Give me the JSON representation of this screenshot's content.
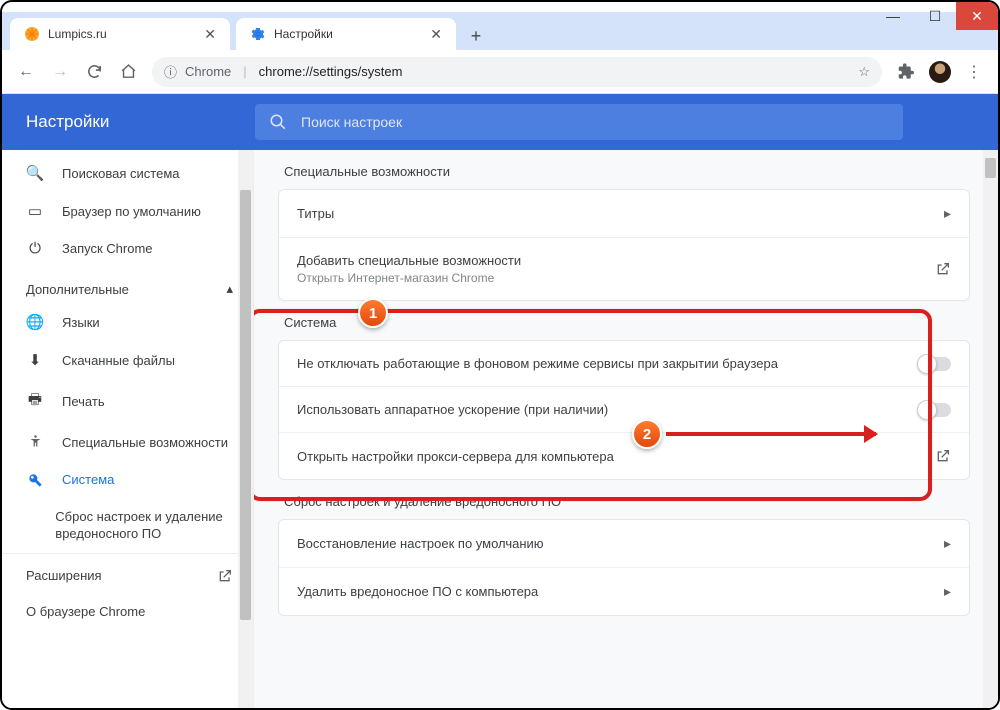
{
  "window": {
    "minimize": "—",
    "maximize": "☐",
    "close": "✕"
  },
  "tabs": [
    {
      "title": "Lumpics.ru",
      "icon": "orange-circle"
    },
    {
      "title": "Настройки",
      "icon": "gear-blue"
    }
  ],
  "newtab": "+",
  "nav": {
    "back": "←",
    "fwd": "→",
    "reload": "↻",
    "home": "⌂"
  },
  "omnibox": {
    "scheme_icon": "ⓘ",
    "scheme_label": "Chrome",
    "url": "chrome://settings/system",
    "star": "☆",
    "ext": "✦",
    "menu": "⋮"
  },
  "header": {
    "title": "Настройки",
    "search_placeholder": "Поиск настроек"
  },
  "sidebar": {
    "items": [
      {
        "icon": "🔍",
        "label": "Поисковая система"
      },
      {
        "icon": "▭",
        "label": "Браузер по умолчанию"
      },
      {
        "icon": "⏻",
        "label": "Запуск Chrome"
      }
    ],
    "adv_label": "Дополнительные",
    "adv_arrow": "▴",
    "adv_items": [
      {
        "icon": "🌐",
        "label": "Языки"
      },
      {
        "icon": "⬇",
        "label": "Скачанные файлы"
      },
      {
        "icon": "🖶",
        "label": "Печать"
      },
      {
        "icon": "✝",
        "label": "Специальные возможности"
      },
      {
        "icon": "🔧",
        "label": "Система",
        "active": true
      },
      {
        "icon": "",
        "label": "Сброс настроек и удаление вредоносного ПО"
      }
    ],
    "ext_label": "Расширения",
    "about_label": "О браузере Chrome"
  },
  "sections": {
    "a11y": {
      "title": "Специальные возможности",
      "row1": "Титры",
      "row2_main": "Добавить специальные возможности",
      "row2_sub": "Открыть Интернет-магазин Chrome"
    },
    "system": {
      "title": "Система",
      "row1": "Не отключать работающие в фоновом режиме сервисы при закрытии браузера",
      "row2": "Использовать аппаратное ускорение (при наличии)",
      "row3": "Открыть настройки прокси-сервера для компьютера"
    },
    "reset": {
      "title": "Сброс настроек и удаление вредоносного ПО",
      "row1": "Восстановление настроек по умолчанию",
      "row2": "Удалить вредоносное ПО с компьютера"
    }
  },
  "annotations": {
    "badge1": "1",
    "badge2": "2"
  }
}
